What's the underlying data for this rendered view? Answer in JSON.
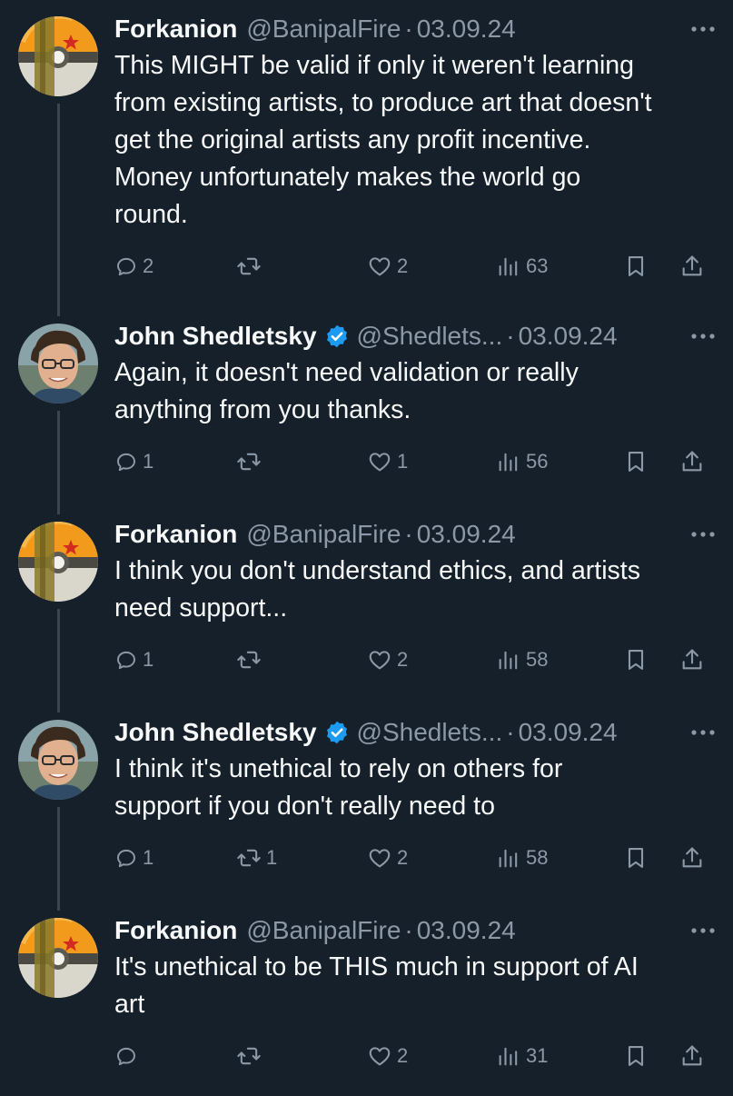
{
  "tweets": [
    {
      "name": "Forkanion",
      "handle": "@BanipalFire",
      "date": "03.09.24",
      "verified": false,
      "avatar": "dragonball-avatar",
      "lines": [
        "This MIGHT be valid if only it weren't learning",
        "from existing artists, to produce art that doesn't",
        "get the original artists any profit incentive.",
        "Money unfortunately makes the world go",
        "round."
      ],
      "replies": "2",
      "retweets": "",
      "likes": "2",
      "views": "63"
    },
    {
      "name": "John Shedletsky",
      "handle": "@Shedlets...",
      "date": "03.09.24",
      "verified": true,
      "avatar": "photo-avatar",
      "lines": [
        "Again, it doesn't need validation or really",
        "anything from you thanks."
      ],
      "replies": "1",
      "retweets": "",
      "likes": "1",
      "views": "56"
    },
    {
      "name": "Forkanion",
      "handle": "@BanipalFire",
      "date": "03.09.24",
      "verified": false,
      "avatar": "dragonball-avatar",
      "lines": [
        "I think you don't understand ethics, and artists",
        "need support..."
      ],
      "replies": "1",
      "retweets": "",
      "likes": "2",
      "views": "58"
    },
    {
      "name": "John Shedletsky",
      "handle": "@Shedlets...",
      "date": "03.09.24",
      "verified": true,
      "avatar": "photo-avatar",
      "lines": [
        "I think it's unethical to rely on others for",
        "support if you don't really need to"
      ],
      "replies": "1",
      "retweets": "1",
      "likes": "2",
      "views": "58"
    },
    {
      "name": "Forkanion",
      "handle": "@BanipalFire",
      "date": "03.09.24",
      "verified": false,
      "avatar": "dragonball-avatar",
      "lines": [
        "It's unethical to be THIS much in support of AI",
        "art"
      ],
      "replies": "",
      "retweets": "",
      "likes": "2",
      "views": "31"
    }
  ],
  "separator": "·",
  "icons": {
    "reply": "reply-icon",
    "retweet": "retweet-icon",
    "like": "heart-icon",
    "views": "views-icon",
    "bookmark": "bookmark-icon",
    "share": "share-icon",
    "more": "more-icon",
    "verified": "verified-badge-icon"
  },
  "colors": {
    "background": "#15202b",
    "text": "#f7f9f9",
    "secondary": "#8b98a5",
    "verified": "#1d9bf0",
    "thread_line": "#3a4550"
  }
}
